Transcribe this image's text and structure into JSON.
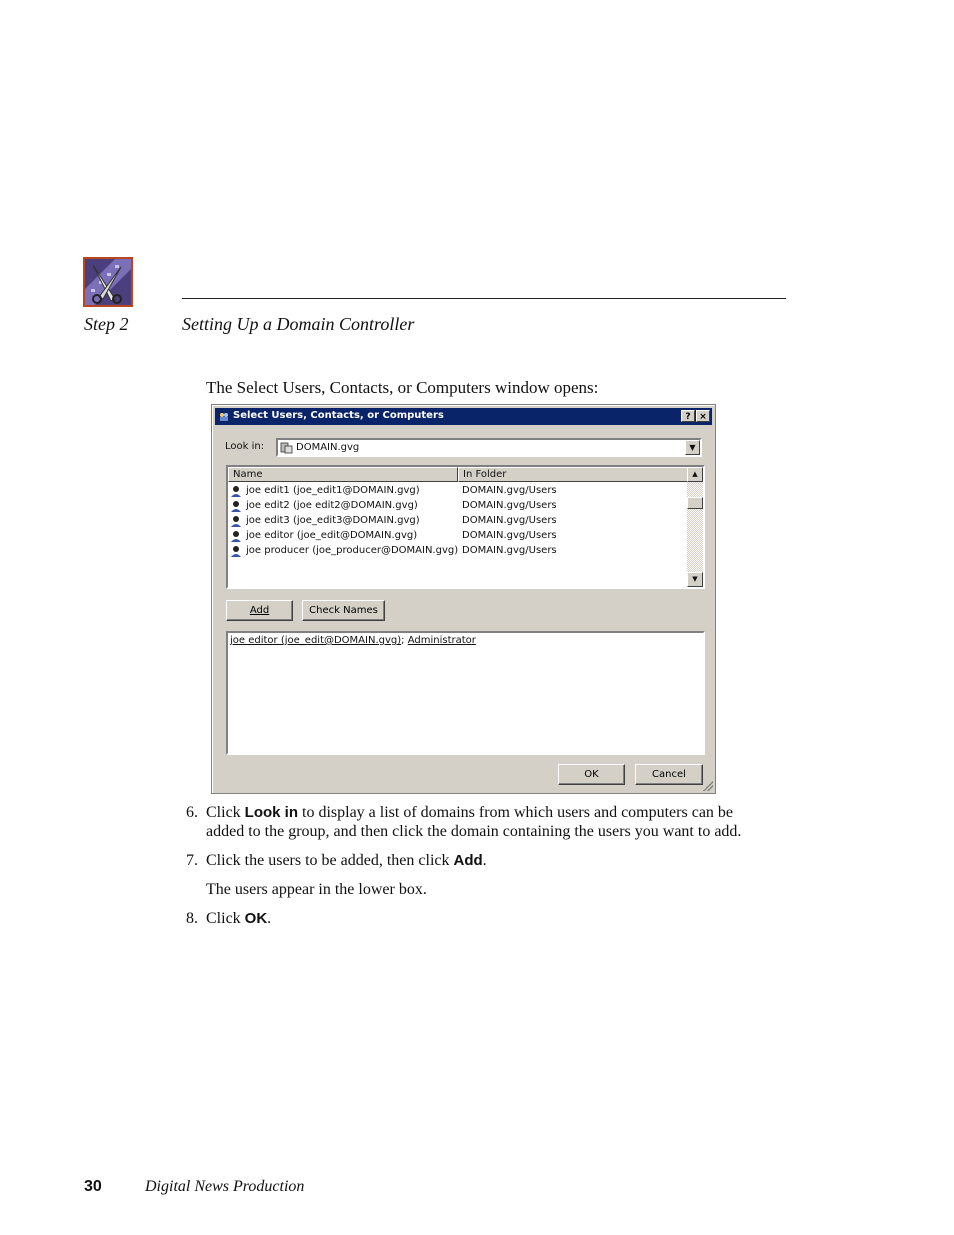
{
  "header": {
    "step": "Step 2",
    "section_title": "Setting Up a Domain Controller"
  },
  "intro_text": "The Select Users, Contacts, or Computers window opens:",
  "dialog": {
    "title": "Select Users, Contacts, or Computers",
    "help_btn": "?",
    "close_btn": "×",
    "look_in_label": "Look in:",
    "look_in_value": "DOMAIN.gvg",
    "columns": [
      "Name",
      "In Folder"
    ],
    "rows": [
      {
        "name": "joe edit1 (joe_edit1@DOMAIN.gvg)",
        "folder": "DOMAIN.gvg/Users"
      },
      {
        "name": "joe edit2 (joe edit2@DOMAIN.gvg)",
        "folder": "DOMAIN.gvg/Users"
      },
      {
        "name": "joe edit3 (joe_edit3@DOMAIN.gvg)",
        "folder": "DOMAIN.gvg/Users"
      },
      {
        "name": "joe editor (joe_edit@DOMAIN.gvg)",
        "folder": "DOMAIN.gvg/Users"
      },
      {
        "name": "joe producer (joe_producer@DOMAIN.gvg)",
        "folder": "DOMAIN.gvg/Users"
      }
    ],
    "add_btn": "Add",
    "check_names_btn": "Check Names",
    "selected_user": "joe editor (joe_edit@DOMAIN.gvg)",
    "selected_sep": "; ",
    "selected_admin": "Administrator",
    "ok_btn": "OK",
    "cancel_btn": "Cancel"
  },
  "steps": {
    "s6_num": "6.",
    "s6_pre": "Click ",
    "s6_bold": "Look in",
    "s6_post": " to display a list of domains from which users and computers can be added to the group, and then click the domain containing the users you want to add.",
    "s7_num": "7.",
    "s7_pre": "Click the users to be added, then click ",
    "s7_bold": "Add",
    "s7_post": ".",
    "s7_sub": "The users appear in the lower box.",
    "s8_num": "8.",
    "s8_pre": "Click ",
    "s8_bold": "OK",
    "s8_post": "."
  },
  "footer": {
    "page_number": "30",
    "book_title": "Digital News Production"
  },
  "colors": {
    "titlebar": "#0a246a",
    "dialog_face": "#d4d0c8",
    "logo_border": "#b8461e"
  }
}
